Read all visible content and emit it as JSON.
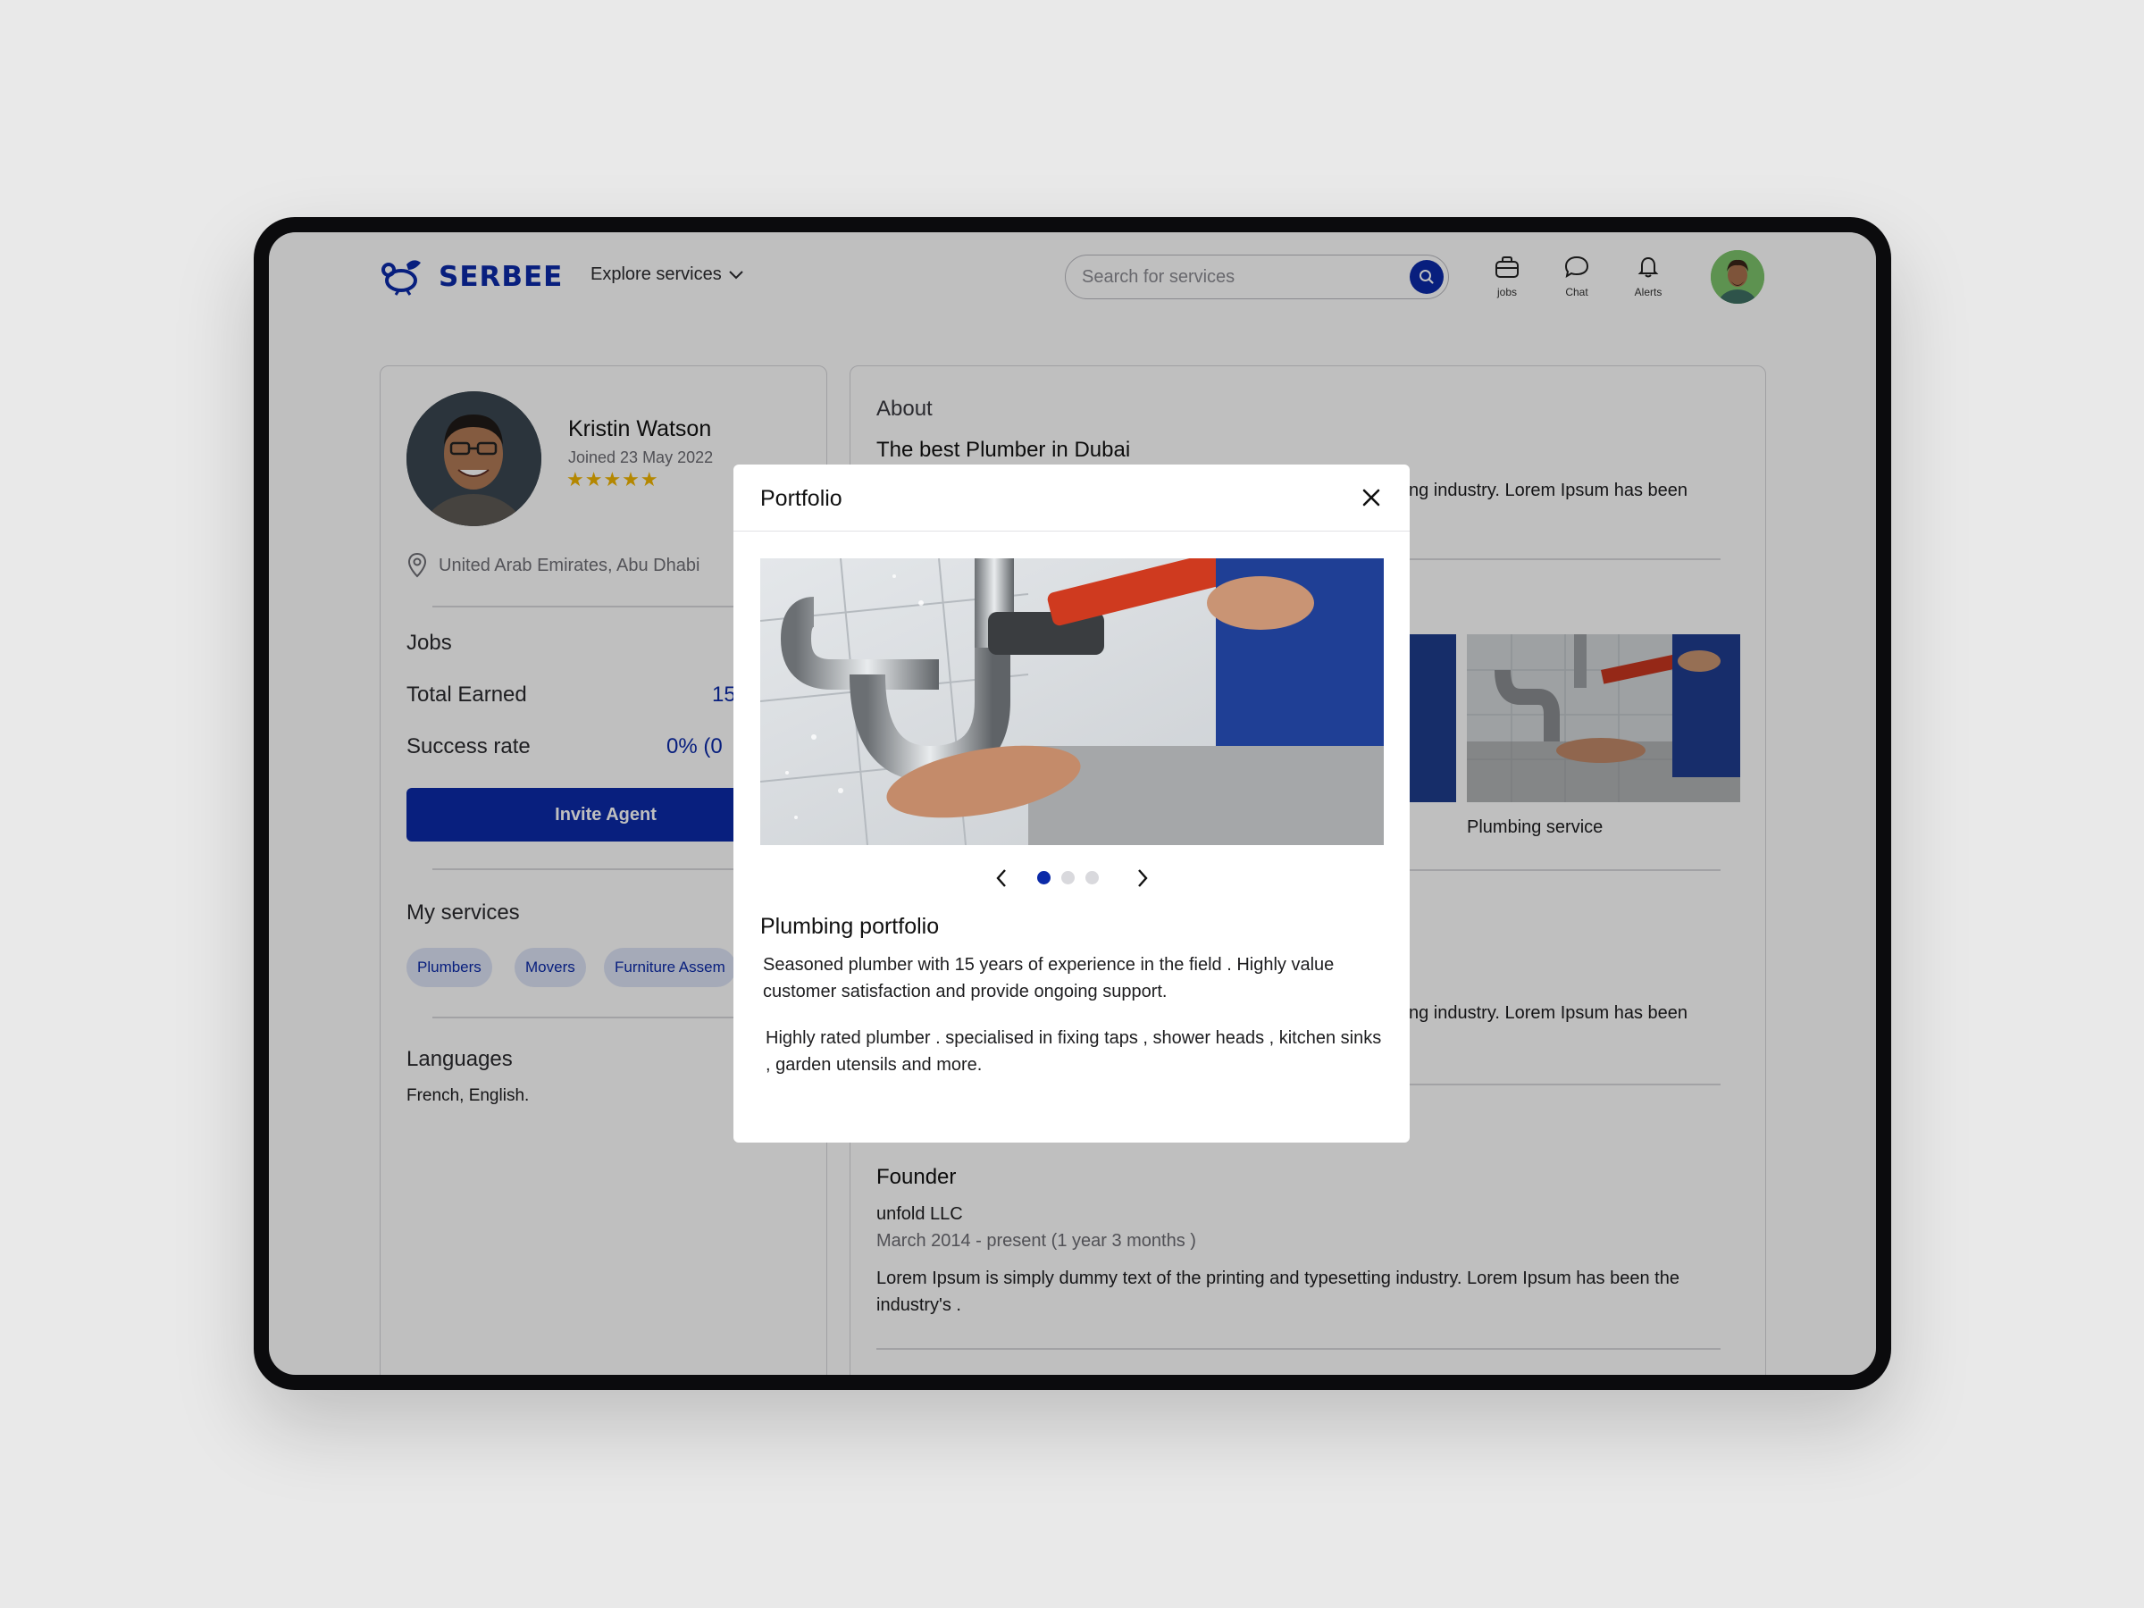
{
  "header": {
    "logo_text": "SERBEE",
    "explore_label": "Explore services",
    "search_placeholder": "Search for services",
    "nav": [
      {
        "label": "jobs",
        "icon": "briefcase-icon"
      },
      {
        "label": "Chat",
        "icon": "chat-bubble-icon"
      },
      {
        "label": "Alerts",
        "icon": "bell-icon"
      }
    ]
  },
  "profile": {
    "name": "Kristin Watson",
    "joined": "Joined  23 May 2022",
    "stars": "★★★★★",
    "location": "United Arab Emirates, Abu Dhabi",
    "jobs_heading": "Jobs",
    "total_earned_label": "Total Earned",
    "total_earned_value": "15",
    "success_rate_label": "Success rate",
    "success_rate_value": "0% (0",
    "invite_label": "Invite Agent",
    "services_heading": "My services",
    "services": [
      "Plumbers",
      "Movers",
      "Furniture Assem"
    ],
    "languages_heading": "Languages",
    "languages": "French, English."
  },
  "about": {
    "heading": "About",
    "title": "The best Plumber in Dubai",
    "text_visible": "ng industry. Lorem Ipsum has been",
    "thumb_caption": "Plumbing service",
    "text_visible_2": "ng industry. Lorem Ipsum has been"
  },
  "experience": {
    "role": "Founder",
    "company": "unfold LLC",
    "period": "March 2014 - present (1 year 3 months )",
    "text": "Lorem Ipsum is simply dummy text of the printing and typesetting industry. Lorem Ipsum has been the industry's ."
  },
  "modal": {
    "title": "Portfolio",
    "slide_count": 3,
    "active_slide": 1,
    "portfolio_title": "Plumbing portfolio",
    "p1": "Seasoned plumber with 15 years of experience in the field . Highly value customer satisfaction and provide ongoing support.",
    "p2": "Highly rated plumber . specialised in fixing taps , shower heads , kitchen sinks , garden utensils and more."
  },
  "colors": {
    "brand": "#0b2aa8",
    "star": "#f0b400",
    "background": "#e9e9e9"
  }
}
